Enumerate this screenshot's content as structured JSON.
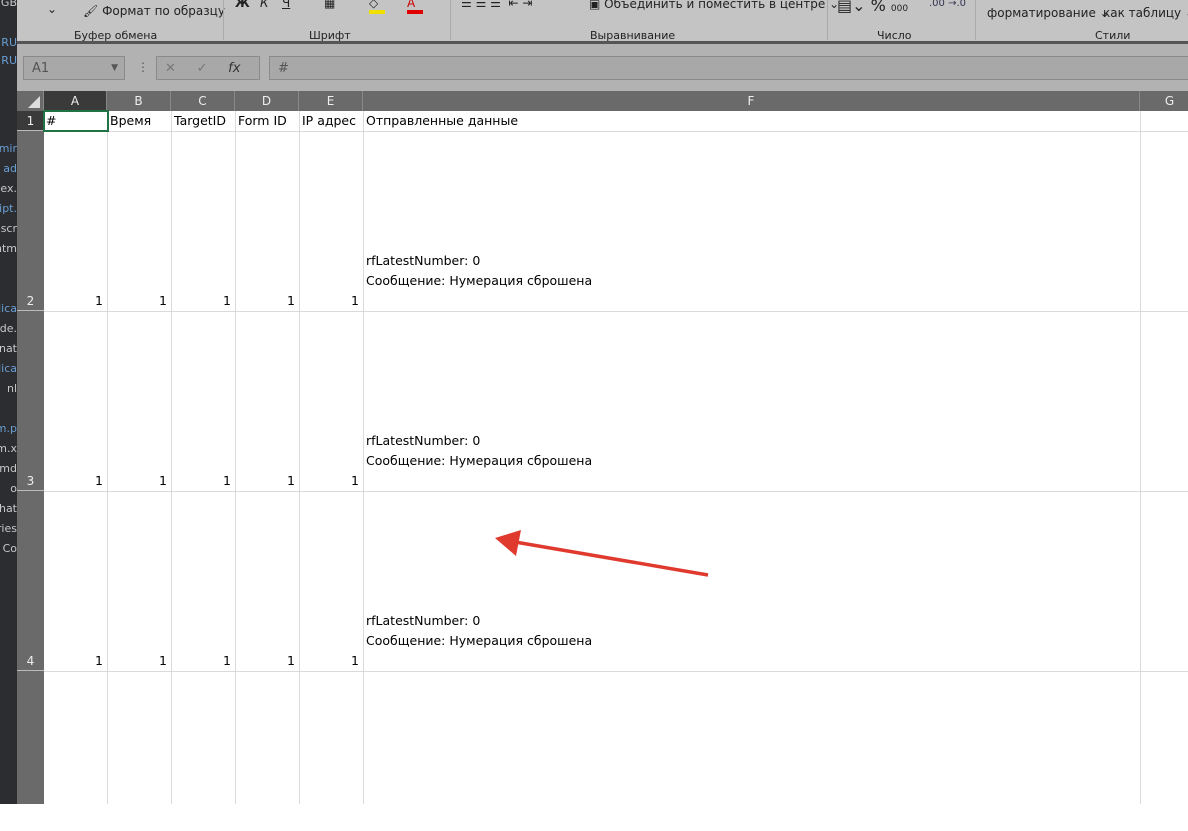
{
  "sidebar_fragments": [
    {
      "text": "-GB",
      "blue": false
    },
    {
      "text": "RU",
      "blue": true
    },
    {
      "text": "RU",
      "blue": true
    },
    {
      "text": "mir",
      "blue": true
    },
    {
      "text": "ad",
      "blue": true
    },
    {
      "text": "lex.",
      "blue": false
    },
    {
      "text": "ipt.",
      "blue": true
    },
    {
      "text": "scr",
      "blue": false
    },
    {
      "text": "htm",
      "blue": false
    },
    {
      "text": "lica",
      "blue": true
    },
    {
      "text": "ode.",
      "blue": false
    },
    {
      "text": "rnat",
      "blue": false
    },
    {
      "text": "lica",
      "blue": true
    },
    {
      "text": "nl",
      "blue": false
    },
    {
      "text": "m.p",
      "blue": true
    },
    {
      "text": "m.x",
      "blue": false
    },
    {
      "text": "md",
      "blue": false
    },
    {
      "text": "o",
      "blue": false
    },
    {
      "text": "chat",
      "blue": false
    },
    {
      "text": "aries",
      "blue": false
    },
    {
      "text": "d Co",
      "blue": false
    }
  ],
  "ribbon": {
    "format_painter": "Формат по образцу",
    "merge_center": "Объединить и поместить в центре",
    "cond_format": "форматирование",
    "as_table": "как таблицу",
    "groups": {
      "clipboard": "Буфер обмена",
      "font": "Шрифт",
      "alignment": "Выравнивание",
      "number": "Число",
      "styles": "Стили"
    },
    "bold": "Ж",
    "italic": "К",
    "underline": "Ч",
    "font_color": "A",
    "percent": "%",
    "thousands": "000"
  },
  "formula_bar": {
    "name_box": "A1",
    "fx": "fx",
    "formula": "#"
  },
  "columns": [
    "A",
    "B",
    "C",
    "D",
    "E",
    "F",
    "G"
  ],
  "header_row": [
    "#",
    "Время",
    "TargetID",
    "Form ID",
    "IP адрес",
    "Отправленные данные"
  ],
  "rows": [
    {
      "num": "1"
    },
    {
      "num": "2",
      "values": [
        "1",
        "1",
        "1",
        "1",
        "1"
      ],
      "line1": "rfLatestNumber: 0",
      "line2": "Сообщение: Нумерация сброшена"
    },
    {
      "num": "3",
      "values": [
        "1",
        "1",
        "1",
        "1",
        "1"
      ],
      "line1": "rfLatestNumber: 0",
      "line2": "Сообщение: Нумерация сброшена"
    },
    {
      "num": "4",
      "values": [
        "1",
        "1",
        "1",
        "1",
        "1"
      ],
      "line1": "rfLatestNumber: 0",
      "line2": "Сообщение: Нумерация сброшена"
    }
  ],
  "annotation_color": "#e03a2f"
}
